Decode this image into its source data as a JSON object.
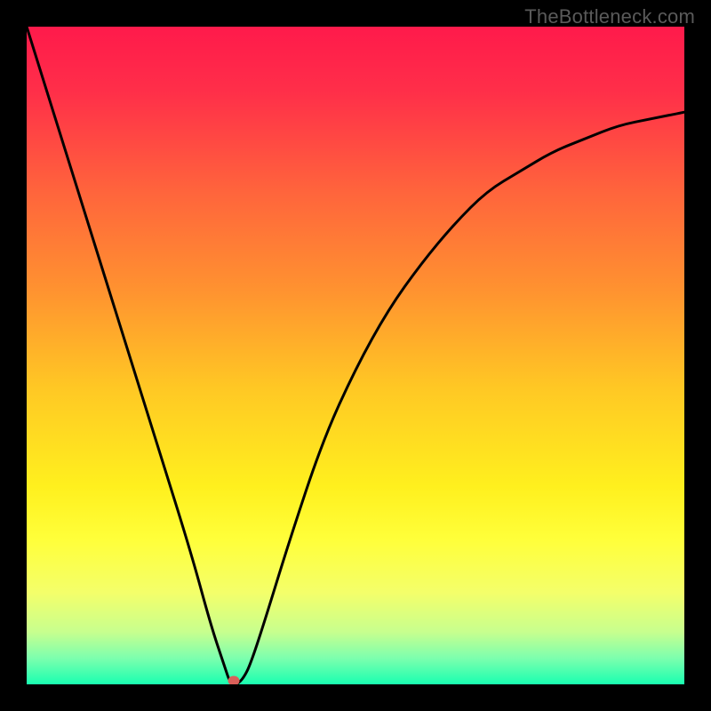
{
  "watermark": "TheBottleneck.com",
  "chart_data": {
    "type": "line",
    "title": "",
    "xlabel": "",
    "ylabel": "",
    "xlim": [
      0,
      100
    ],
    "ylim": [
      0,
      100
    ],
    "grid": false,
    "legend": false,
    "gradient_stops": [
      {
        "offset": 0.0,
        "color": "#ff1a4b"
      },
      {
        "offset": 0.1,
        "color": "#ff2f49"
      },
      {
        "offset": 0.25,
        "color": "#ff643c"
      },
      {
        "offset": 0.4,
        "color": "#ff9230"
      },
      {
        "offset": 0.55,
        "color": "#ffc824"
      },
      {
        "offset": 0.7,
        "color": "#fff01e"
      },
      {
        "offset": 0.78,
        "color": "#ffff3a"
      },
      {
        "offset": 0.86,
        "color": "#f4ff6a"
      },
      {
        "offset": 0.92,
        "color": "#c8ff8e"
      },
      {
        "offset": 0.96,
        "color": "#7dffae"
      },
      {
        "offset": 1.0,
        "color": "#19ffb0"
      }
    ],
    "series": [
      {
        "name": "bottleneck-curve",
        "x": [
          0,
          5,
          10,
          15,
          20,
          25,
          28,
          30,
          31,
          32,
          33,
          34,
          36,
          40,
          45,
          50,
          55,
          60,
          65,
          70,
          75,
          80,
          85,
          90,
          95,
          100
        ],
        "y": [
          100,
          84,
          68,
          52,
          36,
          20,
          9,
          3,
          0,
          0,
          1,
          3,
          9,
          22,
          37,
          48,
          57,
          64,
          70,
          75,
          78,
          81,
          83,
          85,
          86,
          87
        ]
      }
    ],
    "marker": {
      "x": 31.5,
      "y": 0.5,
      "color": "#d9605a"
    }
  }
}
